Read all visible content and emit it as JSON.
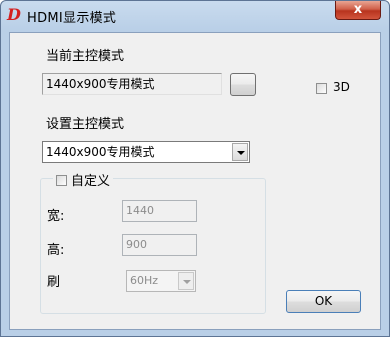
{
  "window": {
    "title": "HDMI显示模式",
    "app_icon_glyph": "D",
    "close_glyph": "x"
  },
  "current_mode": {
    "label": "当前主控模式",
    "value": "1440x900专用模式",
    "browse_label": ""
  },
  "checkbox_3d": {
    "label": "3D",
    "checked": false
  },
  "set_mode": {
    "label": "设置主控模式",
    "selected": "1440x900专用模式"
  },
  "custom_group": {
    "label": "自定义",
    "checked": false,
    "width_label": "宽:",
    "width_value": "1440",
    "height_label": "高:",
    "height_value": "900",
    "refresh_label": "刷",
    "refresh_selected": "60Hz"
  },
  "ok_button": {
    "label": "OK"
  },
  "colors": {
    "frame": "#b9cfe7",
    "client": "#f0f0f0",
    "close_button": "#c8462e",
    "icon": "#d42020"
  }
}
